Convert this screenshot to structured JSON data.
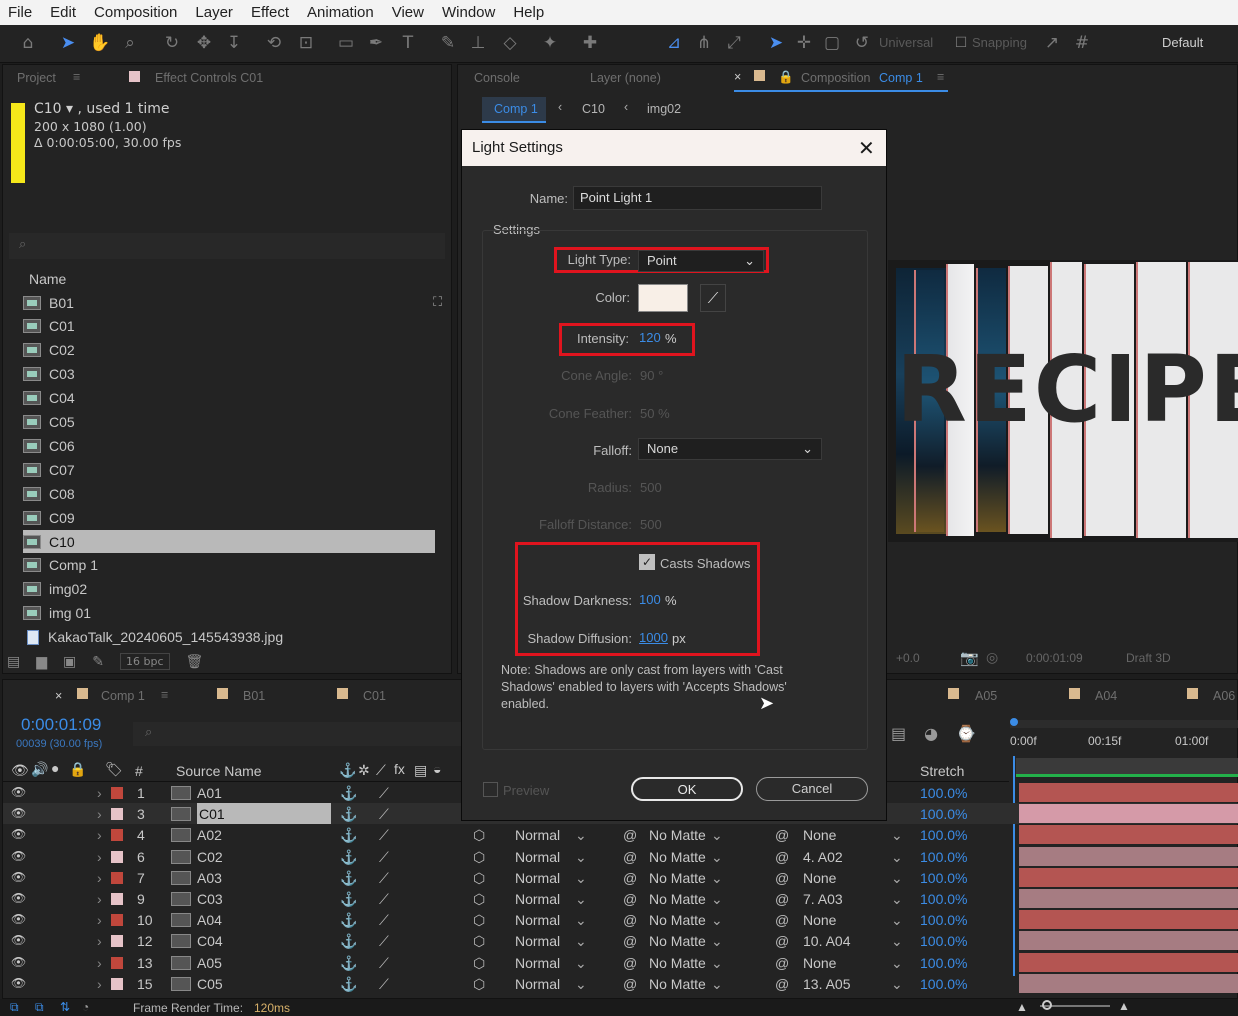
{
  "menu": [
    "File",
    "Edit",
    "Composition",
    "Layer",
    "Effect",
    "Animation",
    "View",
    "Window",
    "Help"
  ],
  "toolbar": {
    "universal": "Universal",
    "snapping": "Snapping",
    "workspace": "Default"
  },
  "project": {
    "tab": "Project",
    "effect_tab": "Effect Controls C01",
    "item_name": "C10",
    "used": ", used 1 time",
    "dims": "200 x 1080 (1.00)",
    "duration": "Δ 0:00:05:00, 30.00 fps",
    "col_name": "Name",
    "bpc": "16 bpc",
    "items": [
      "B01",
      "C01",
      "C02",
      "C03",
      "C04",
      "C05",
      "C06",
      "C07",
      "C08",
      "C09",
      "C10",
      "Comp 1",
      "img02",
      "img 01",
      "KakaoTalk_20240605_145543938.jpg"
    ]
  },
  "comp": {
    "console_tab": "Console",
    "layer_tab": "Layer (none)",
    "comp_tab": "Composition",
    "comp_name": "Comp 1",
    "crumbs": [
      "Comp 1",
      "C10",
      "img02"
    ],
    "preview_text": "RECIPE",
    "zoom": "+0.0",
    "timecode": "0:00:01:09",
    "draft": "Draft 3D"
  },
  "dialog": {
    "title": "Light Settings",
    "name_label": "Name:",
    "name_value": "Point Light 1",
    "settings_label": "Settings",
    "light_type_label": "Light Type:",
    "light_type": "Point",
    "color_label": "Color:",
    "intensity_label": "Intensity:",
    "intensity": "120",
    "pct": "%",
    "cone_angle_label": "Cone Angle:",
    "cone_angle": "90 °",
    "cone_feather_label": "Cone Feather:",
    "cone_feather": "50 %",
    "falloff_label": "Falloff:",
    "falloff": "None",
    "radius_label": "Radius:",
    "radius": "500",
    "falloff_dist_label": "Falloff Distance:",
    "falloff_dist": "500",
    "casts_shadows": "Casts Shadows",
    "shadow_dark_label": "Shadow Darkness:",
    "shadow_dark": "100",
    "shadow_diff_label": "Shadow Diffusion:",
    "shadow_diff": "1000",
    "px": "px",
    "note": "Note: Shadows are only cast from layers with 'Cast Shadows' enabled to layers with 'Accepts Shadows' enabled.",
    "preview": "Preview",
    "ok": "OK",
    "cancel": "Cancel"
  },
  "timeline": {
    "tabs": [
      "Comp 1",
      "B01",
      "C01",
      "A05",
      "A04",
      "A06"
    ],
    "timecode": "0:00:01:09",
    "frames": "00039 (30.00 fps)",
    "col_num": "#",
    "col_source": "Source Name",
    "col_stretch": "Stretch",
    "ruler": [
      "0:00f",
      "00:15f",
      "01:00f"
    ],
    "frame_render": "Frame Render Time:",
    "render_ms": "120ms",
    "rows": [
      {
        "num": "1",
        "name": "A01",
        "color": "#c0473c",
        "mode": "",
        "matte": "",
        "parent": "",
        "stretch": "100.0%"
      },
      {
        "num": "3",
        "name": "C01",
        "color": "#e6c3c8",
        "mode": "",
        "matte": "",
        "parent": "",
        "stretch": "100.0%"
      },
      {
        "num": "4",
        "name": "A02",
        "color": "#c0473c",
        "mode": "Normal",
        "matte": "No Matte",
        "parent": "None",
        "stretch": "100.0%"
      },
      {
        "num": "6",
        "name": "C02",
        "color": "#e6c3c8",
        "mode": "Normal",
        "matte": "No Matte",
        "parent": "4. A02",
        "stretch": "100.0%"
      },
      {
        "num": "7",
        "name": "A03",
        "color": "#c0473c",
        "mode": "Normal",
        "matte": "No Matte",
        "parent": "None",
        "stretch": "100.0%"
      },
      {
        "num": "9",
        "name": "C03",
        "color": "#e6c3c8",
        "mode": "Normal",
        "matte": "No Matte",
        "parent": "7. A03",
        "stretch": "100.0%"
      },
      {
        "num": "10",
        "name": "A04",
        "color": "#c0473c",
        "mode": "Normal",
        "matte": "No Matte",
        "parent": "None",
        "stretch": "100.0%"
      },
      {
        "num": "12",
        "name": "C04",
        "color": "#e6c3c8",
        "mode": "Normal",
        "matte": "No Matte",
        "parent": "10. A04",
        "stretch": "100.0%"
      },
      {
        "num": "13",
        "name": "A05",
        "color": "#c0473c",
        "mode": "Normal",
        "matte": "No Matte",
        "parent": "None",
        "stretch": "100.0%"
      },
      {
        "num": "15",
        "name": "C05",
        "color": "#e6c3c8",
        "mode": "Normal",
        "matte": "No Matte",
        "parent": "13. A05",
        "stretch": "100.0%"
      }
    ]
  },
  "colors": {
    "accent": "#3b8ce6",
    "highlight_box": "#e0141e",
    "label_yellow": "#f5e71a"
  }
}
